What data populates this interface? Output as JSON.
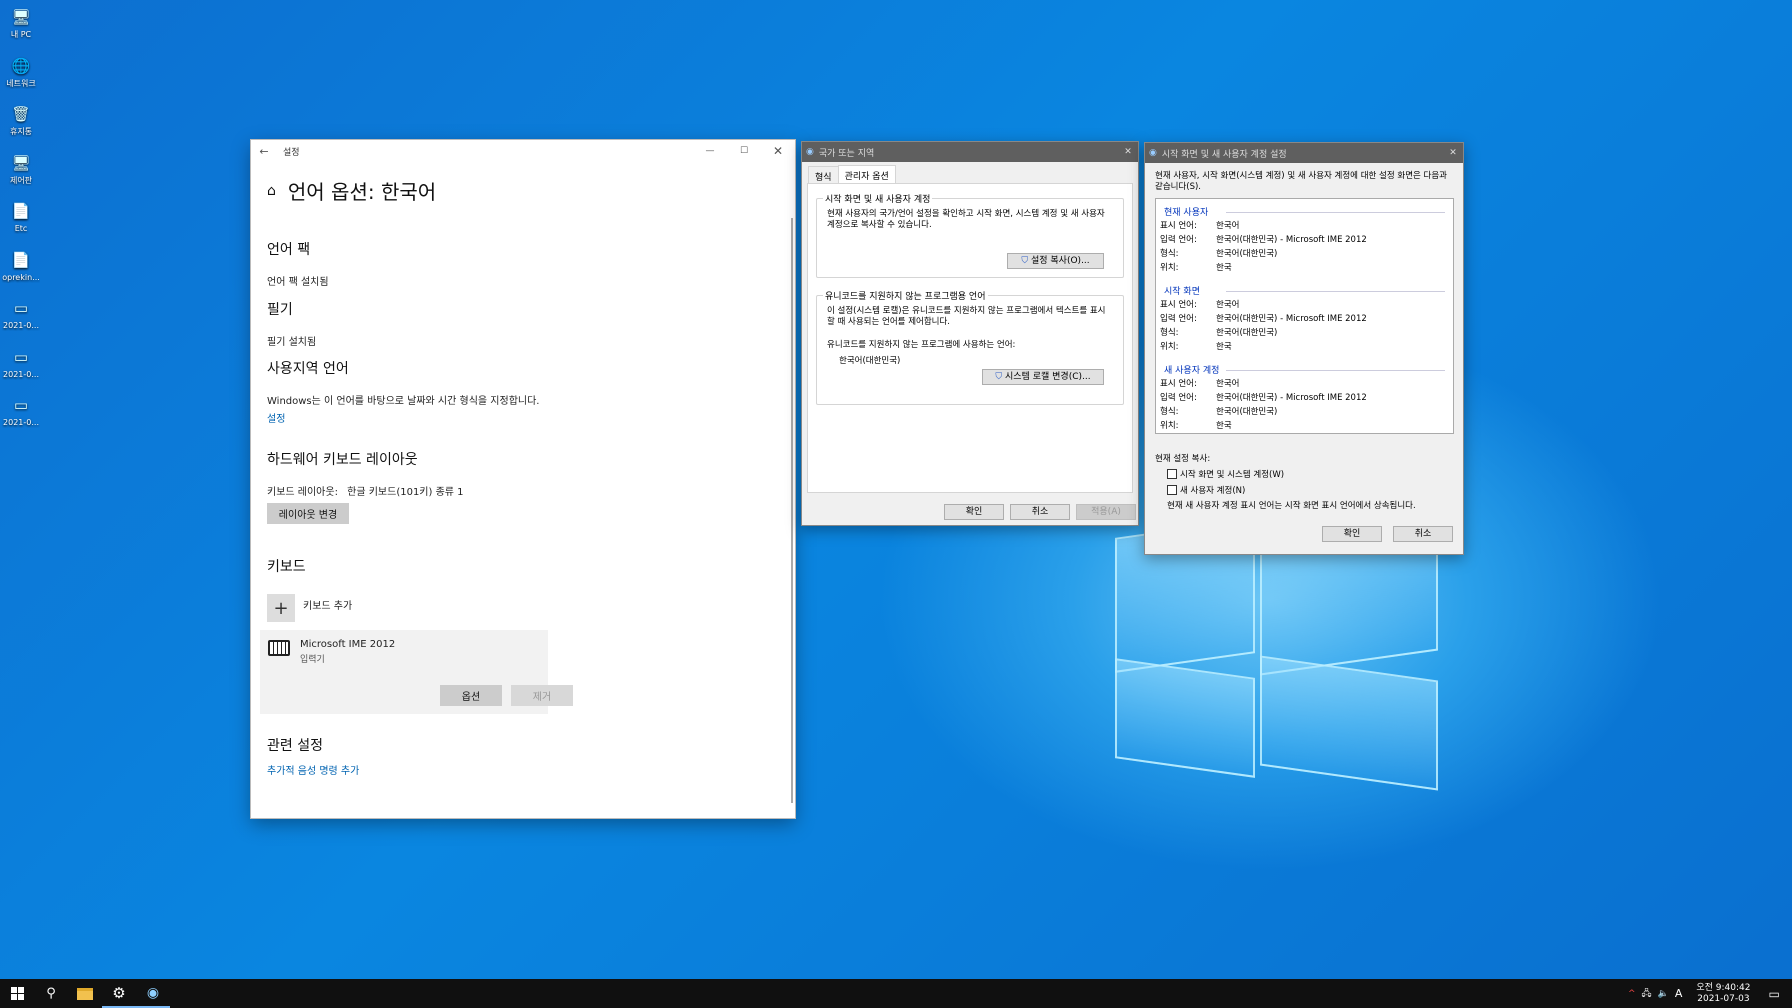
{
  "desktop": {
    "icons": [
      {
        "label": "내 PC",
        "icon": "computer-icon"
      },
      {
        "label": "네트워크",
        "icon": "network-icon"
      },
      {
        "label": "휴지통",
        "icon": "recycle-bin-icon"
      },
      {
        "label": "제어판",
        "icon": "control-panel-icon"
      },
      {
        "label": "Etc",
        "icon": "file-icon"
      },
      {
        "label": "oprekin...",
        "icon": "shortcut-icon"
      },
      {
        "label": "2021-0...",
        "icon": "screenshot-icon"
      },
      {
        "label": "2021-0...",
        "icon": "screenshot-icon"
      },
      {
        "label": "2021-0...",
        "icon": "screenshot-icon"
      }
    ]
  },
  "settings": {
    "window_title": "설정",
    "page_title": "언어 옵션: 한국어",
    "language_pack": {
      "heading": "언어 팩",
      "status": "언어 팩 설치됨"
    },
    "handwriting": {
      "heading": "필기",
      "status": "필기 설치됨"
    },
    "regional": {
      "heading": "사용지역 언어",
      "description": "Windows는 이 언어를 바탕으로 날짜와 시간 형식을 지정합니다.",
      "link": "설정"
    },
    "hardware_keyboard": {
      "heading": "하드웨어 키보드 레이아웃",
      "layout_label": "키보드 레이아웃:",
      "layout_value": "한글 키보드(101키) 종류 1",
      "change_button": "레이아웃 변경"
    },
    "keyboard": {
      "heading": "키보드",
      "add_label": "키보드 추가",
      "ime_name": "Microsoft IME 2012",
      "ime_type": "입력기",
      "options_button": "옵션",
      "remove_button": "제거"
    },
    "related": {
      "heading": "관련 설정",
      "link": "추가적 음성 명령 추가"
    }
  },
  "region_dialog": {
    "title": "국가 또는 지역",
    "tabs": [
      "형식",
      "관리자 옵션"
    ],
    "active_tab": "관리자 옵션",
    "welcome_group": {
      "label": "시작 화면 및 새 사용자 계정",
      "description": "현재 사용자의 국가/언어 설정을 확인하고 시작 화면, 시스템 계정 및 새 사용자 계정으로 복사할 수 있습니다.",
      "button": "설정 복사(O)..."
    },
    "unicode_group": {
      "label": "유니코드를 지원하지 않는 프로그램용 언어",
      "description": "이 설정(시스템 로캘)은 유니코드를 지원하지 않는 프로그램에서 텍스트를 표시할 때 사용되는 언어를 제어합니다.",
      "current_label": "유니코드를 지원하지 않는 프로그램에 사용하는 언어:",
      "current_value": "한국어(대한민국)",
      "button": "시스템 로캘 변경(C)..."
    },
    "ok": "확인",
    "cancel": "취소",
    "apply": "적용(A)"
  },
  "welcome_dialog": {
    "title": "시작 화면 및 새 사용자 계정 설정",
    "intro": "현재 사용자, 시작 화면(시스템 계정) 및 새 사용자 계정에 대한 설정 화면은 다음과 같습니다(S).",
    "sections": [
      {
        "name": "현재 사용자",
        "rows": [
          {
            "k": "표시 언어:",
            "v": "한국어"
          },
          {
            "k": "입력 언어:",
            "v": "한국어(대한민국) - Microsoft IME 2012"
          },
          {
            "k": "형식:",
            "v": "한국어(대한민국)"
          },
          {
            "k": "위치:",
            "v": "한국"
          }
        ]
      },
      {
        "name": "시작 화면",
        "rows": [
          {
            "k": "표시 언어:",
            "v": "한국어"
          },
          {
            "k": "입력 언어:",
            "v": "한국어(대한민국) - Microsoft IME 2012"
          },
          {
            "k": "형식:",
            "v": "한국어(대한민국)"
          },
          {
            "k": "위치:",
            "v": "한국"
          }
        ]
      },
      {
        "name": "새 사용자 계정",
        "rows": [
          {
            "k": "표시 언어:",
            "v": "한국어"
          },
          {
            "k": "입력 언어:",
            "v": "한국어(대한민국) - Microsoft IME 2012"
          },
          {
            "k": "형식:",
            "v": "한국어(대한민국)"
          },
          {
            "k": "위치:",
            "v": "한국"
          }
        ]
      }
    ],
    "copy_label": "현재 설정 복사:",
    "checkbox_welcome": "시작 화면 및 시스템 계정(W)",
    "checkbox_new_user": "새 사용자 계정(N)",
    "note": "현재 새 사용자 계정 표시 언어는 시작 화면 표시 언어에서 상속됩니다.",
    "ok": "확인",
    "cancel": "취소"
  },
  "taskbar": {
    "ime_indicator": "A",
    "time": "오전 9:40:42",
    "date": "2021-07-03"
  }
}
